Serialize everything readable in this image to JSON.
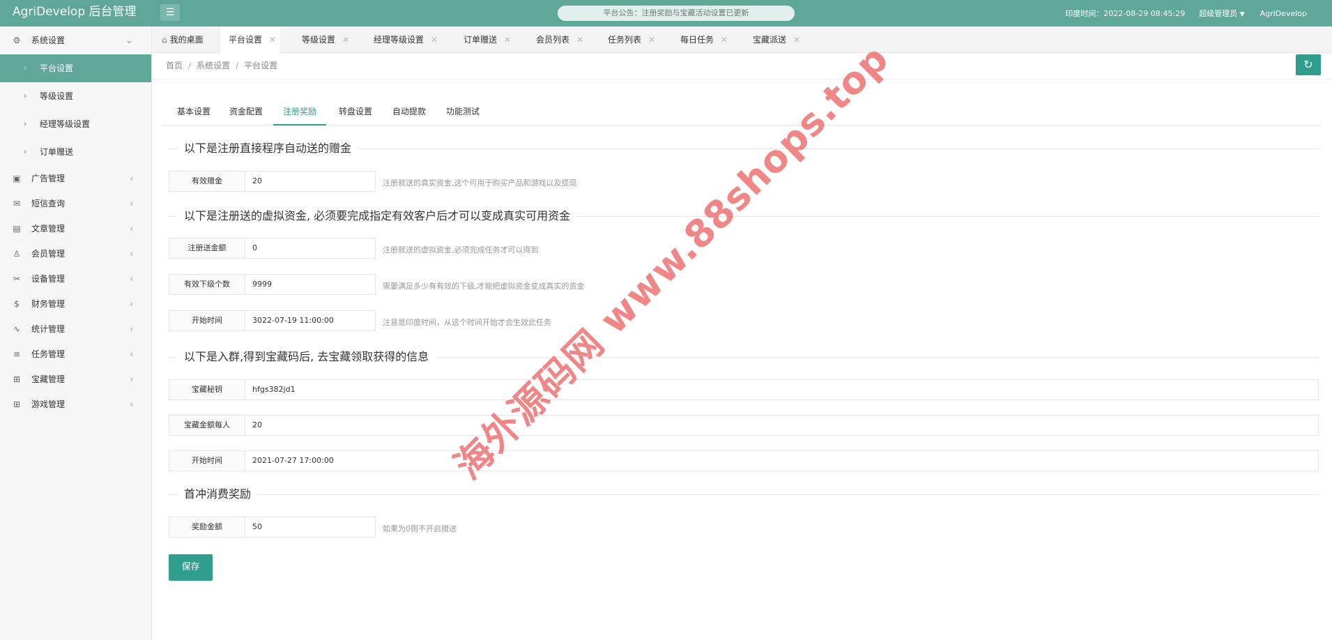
{
  "header": {
    "brand": "AgriDevelop 后台管理",
    "menu_icon": "menu-icon",
    "notice": "平台公告：注册奖励与宝藏活动设置已更新",
    "time_label": "印度时间：",
    "time_value": "2022-08-29 08:45:29",
    "admin_label": "超级管理员",
    "caret": "▼",
    "user": "AgriDevelop"
  },
  "sidebar": {
    "system": {
      "label": "系统设置",
      "icon": "gear-icon",
      "arrow": "⌄"
    },
    "sub_items": [
      {
        "label": "平台设置"
      },
      {
        "label": "等级设置"
      },
      {
        "label": "经理等级设置"
      },
      {
        "label": "订单赠送"
      }
    ],
    "items": [
      {
        "label": "广告管理",
        "icon": "image-icon"
      },
      {
        "label": "短信查询",
        "icon": "mail-icon"
      },
      {
        "label": "文章管理",
        "icon": "book-icon"
      },
      {
        "label": "会员管理",
        "icon": "user-icon"
      },
      {
        "label": "设备管理",
        "icon": "tools-icon"
      },
      {
        "label": "财务管理",
        "icon": "dollar-icon"
      },
      {
        "label": "统计管理",
        "icon": "pulse-icon"
      },
      {
        "label": "任务管理",
        "icon": "sliders-icon"
      },
      {
        "label": "宝藏管理",
        "icon": "gift-icon"
      },
      {
        "label": "游戏管理",
        "icon": "gift-icon"
      }
    ]
  },
  "tabs": [
    {
      "label": "我的桌面"
    },
    {
      "label": "平台设置"
    },
    {
      "label": "等级设置"
    },
    {
      "label": "经理等级设置"
    },
    {
      "label": "订单赠送"
    },
    {
      "label": "会员列表"
    },
    {
      "label": "任务列表"
    },
    {
      "label": "每日任务"
    },
    {
      "label": "宝藏派送"
    }
  ],
  "breadcrumb": {
    "home": "首页",
    "level1": "系统设置",
    "level2": "平台设置",
    "sep": "/"
  },
  "subtabs": [
    "基本设置",
    "资金配置",
    "注册奖励",
    "转盘设置",
    "自动提款",
    "功能测试"
  ],
  "sections": {
    "s1": "以下是注册直接程序自动送的赠金",
    "s2": "以下是注册送的虚拟资金, 必须要完成指定有效客户后才可以变成真实可用资金",
    "s3": "以下是入群,得到宝藏码后, 去宝藏领取获得的信息",
    "s4": "首冲消费奖励"
  },
  "fields": {
    "valid_bonus": {
      "label": "有效赠金",
      "value": "20",
      "tip": "注册就送的真实资金,这个可用于购买产品和游戏以及提现"
    },
    "reg_amount": {
      "label": "注册送金额",
      "value": "0",
      "tip": "注册就送的虚拟资金,必须完成任务才可以得到"
    },
    "valid_sub": {
      "label": "有效下级个数",
      "value": "9999",
      "tip": "需要满足多少有有效的下级,才能把虚拟资金变成真实的资金"
    },
    "start_time": {
      "label": "开始时间",
      "value": "3022-07-19 11:00:00",
      "tip": "注意是印度时间，从这个时间开始才会生效此任务"
    },
    "treasure_key": {
      "label": "宝藏秘钥",
      "value": "hfgs382jd1"
    },
    "treasure_amount": {
      "label": "宝藏金额每人",
      "value": "20"
    },
    "treasure_start": {
      "label": "开始时间",
      "value": "2021-07-27 17:00:00"
    },
    "reward_amount": {
      "label": "奖励金额",
      "value": "50",
      "tip": "如果为0则不开启赠送"
    }
  },
  "save_label": "保存",
  "watermark": "海外源码网 www.88shops.top",
  "colors": {
    "header": "#5fa898",
    "accent": "#2f9e8e",
    "watermark": "#ec6464"
  }
}
